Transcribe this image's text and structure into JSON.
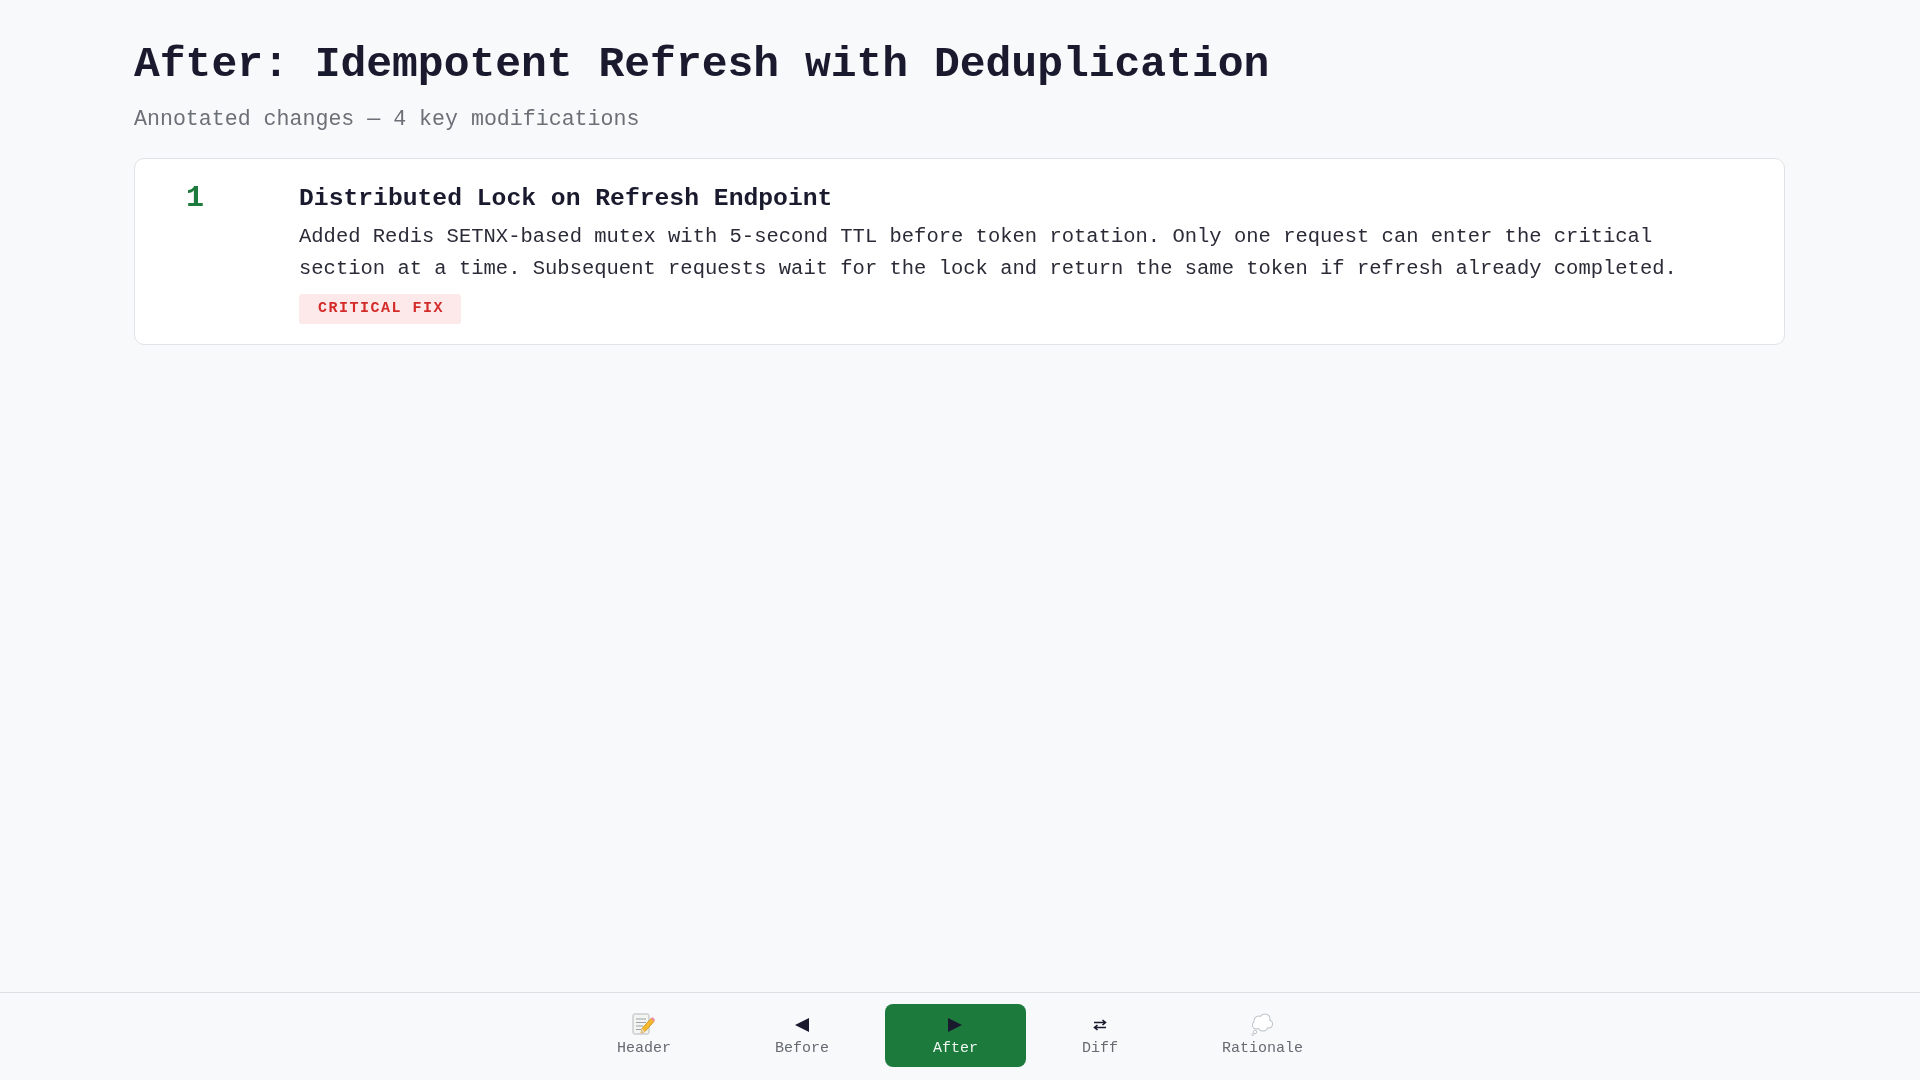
{
  "page": {
    "title": "After: Idempotent Refresh with Deduplication",
    "subtitle": "Annotated changes — 4 key modifications"
  },
  "changes": [
    {
      "number": "1",
      "title": "Distributed Lock on Refresh Endpoint",
      "description": "Added Redis SETNX-based mutex with 5-second TTL before token rotation. Only one request can enter the critical section at a time. Subsequent requests wait for the lock and return the same token if refresh already completed.",
      "tag": {
        "label": "CRITICAL FIX",
        "kind": "critical"
      }
    }
  ],
  "nav": {
    "tabs": [
      {
        "label": "Header",
        "selected": false
      },
      {
        "label": "Before",
        "selected": false
      },
      {
        "label": "After",
        "selected": true
      },
      {
        "label": "Diff",
        "selected": false
      },
      {
        "label": "Rationale",
        "selected": false
      }
    ]
  }
}
